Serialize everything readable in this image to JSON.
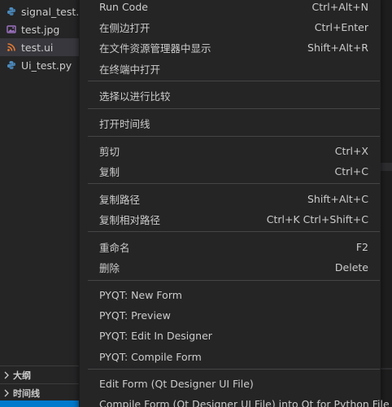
{
  "explorer": {
    "files": [
      {
        "label": "signal_test.py",
        "icon": "python-icon"
      },
      {
        "label": "test.jpg",
        "icon": "image-icon"
      },
      {
        "label": "test.ui",
        "icon": "rss-icon"
      },
      {
        "label": "Ui_test.py",
        "icon": "python-icon"
      }
    ],
    "sections": [
      {
        "label": "大纲",
        "icon": "chevron-right-icon"
      },
      {
        "label": "时间线",
        "icon": "chevron-right-icon"
      }
    ]
  },
  "context_menu": {
    "items": [
      {
        "label": "Run Code",
        "shortcut": "Ctrl+Alt+N"
      },
      {
        "label": "在侧边打开",
        "shortcut": "Ctrl+Enter"
      },
      {
        "label": "在文件资源管理器中显示",
        "shortcut": "Shift+Alt+R"
      },
      {
        "label": "在终端中打开",
        "shortcut": ""
      },
      {
        "label": "选择以进行比较",
        "shortcut": ""
      },
      {
        "label": "打开时间线",
        "shortcut": ""
      },
      {
        "label": "剪切",
        "shortcut": "Ctrl+X"
      },
      {
        "label": "复制",
        "shortcut": "Ctrl+C"
      },
      {
        "label": "复制路径",
        "shortcut": "Shift+Alt+C"
      },
      {
        "label": "复制相对路径",
        "shortcut": "Ctrl+K Ctrl+Shift+C"
      },
      {
        "label": "重命名",
        "shortcut": "F2"
      },
      {
        "label": "删除",
        "shortcut": "Delete"
      },
      {
        "label": "PYQT: New Form",
        "shortcut": ""
      },
      {
        "label": "PYQT: Preview",
        "shortcut": ""
      },
      {
        "label": "PYQT: Edit In Designer",
        "shortcut": ""
      },
      {
        "label": "PYQT: Compile Form",
        "shortcut": ""
      },
      {
        "label": "Edit Form (Qt Designer UI File)",
        "shortcut": ""
      },
      {
        "label": "Compile Form (Qt Designer UI File) into Qt for Python File",
        "shortcut": ""
      }
    ]
  },
  "colors": {
    "menu_background": "#252526",
    "menu_text": "#cccccc",
    "separator": "#454545",
    "selected_file": "#37373d",
    "status_bar": "#007acc",
    "python_icon": "#4b8bbe",
    "image_icon": "#a074c4",
    "rss_icon": "#e37933"
  }
}
